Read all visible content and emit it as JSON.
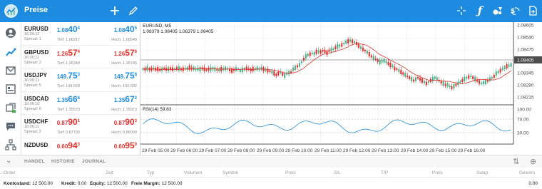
{
  "app": {
    "title": "Preise"
  },
  "toolbar": {
    "icons": [
      "plus-icon",
      "pencil-icon",
      "crosshair-icon",
      "function-icon",
      "shapes-icon",
      "currency-exchange-icon",
      "add-to-chart-icon"
    ]
  },
  "sidebar": {
    "icons": [
      "account-icon",
      "chart-icon",
      "mail-icon",
      "calendar-icon",
      "trade-icon",
      "chat-icon",
      "network-icon"
    ]
  },
  "quotes": [
    {
      "symbol": "EURUSD",
      "time": "16:06:11",
      "spread": "Spread: 1",
      "bid_main": "1.08",
      "bid_big": "40",
      "bid_sup": "4",
      "ask_main": "1.08",
      "ask_big": "40",
      "ask_sup": "5",
      "low": "Tief: 1.08217",
      "high": "Hoch: 1.08549",
      "dir": "up"
    },
    {
      "symbol": "GBPUSD",
      "time": "16:06:11",
      "spread": "Spread: 2",
      "bid_main": "1.26",
      "bid_big": "57",
      "bid_sup": "4",
      "ask_main": "1.26",
      "ask_big": "57",
      "ask_sup": "6",
      "low": "Tief: 1.26349",
      "high": "Hoch: 1.26745",
      "dir": "down"
    },
    {
      "symbol": "USDJPY",
      "time": "16:06:11",
      "spread": "Spread: 5",
      "bid_main": "149.",
      "bid_big": "75",
      "bid_sup": "3",
      "ask_main": "149.",
      "ask_big": "75",
      "ask_sup": "8",
      "low": "Tief: 149.609",
      "high": "Hoch: 150.692",
      "dir": "up"
    },
    {
      "symbol": "USDCAD",
      "time": "16:06:10",
      "spread": "Spread: 6",
      "bid_main": "1.35",
      "bid_big": "66",
      "bid_sup": "6",
      "ask_main": "1.35",
      "ask_big": "67",
      "ask_sup": "2",
      "low": "Tief: 1.35579",
      "high": "Hoch: 1.35973",
      "dir": "up"
    },
    {
      "symbol": "USDCHF",
      "time": "16:06:11",
      "spread": "Spread: 2",
      "bid_main": "0.87",
      "bid_big": "90",
      "bid_sup": "1",
      "ask_main": "0.87",
      "ask_big": "90",
      "ask_sup": "3",
      "low": "Tief: 0.87793",
      "high": "Hoch: 0.88099",
      "dir": "down"
    },
    {
      "symbol": "NZDUSD",
      "time": "",
      "spread": "",
      "bid_main": "0.60",
      "bid_big": "94",
      "bid_sup": "3",
      "ask_main": "0.60",
      "ask_big": "95",
      "ask_sup": "0",
      "low": "",
      "high": "",
      "dir": "down"
    }
  ],
  "chart": {
    "symbol_line": "EURUSD, M5",
    "ohlc_line": "1.08379 1.08405 1.08379 1.08405",
    "rsi_label": "RSI(14) 59.83",
    "price_labels": [
      "1.08605",
      "1.08540",
      "1.08475",
      "1.08405",
      "1.08345",
      "1.08280",
      "1.08215"
    ],
    "current_price": "1.08405",
    "rsi_levels": [
      "100.00",
      "70.00",
      "30.00",
      "0.00"
    ],
    "time_labels": [
      "29 Feb 05:00",
      "29 Feb 06:00",
      "29 Feb 07:00",
      "29 Feb 08:00",
      "29 Feb 09:00",
      "29 Feb 10:00",
      "29 Feb 11:00",
      "29 Feb 12:00",
      "29 Feb 13:00",
      "29 Feb 14:00",
      "29 Feb 15:00",
      "29 Feb 16:00"
    ],
    "up_color": "#4caf87",
    "down_color": "#e2322e",
    "ma_color": "#e2322e",
    "rsi_color": "#1d8ce0"
  },
  "tabs": {
    "trade": "HANDEL",
    "history": "HISTORIE",
    "journal": "JOURNAL"
  },
  "table_headers": [
    "Order",
    "Zeit",
    "Typ",
    "Volumen",
    "Symbol",
    "Preis",
    "S/L",
    "T/P",
    "Preis",
    "Swap",
    "Gewinn"
  ],
  "status": {
    "balance_label": "Kontostand:",
    "balance": "12 500.00",
    "credit_label": "Kredit:",
    "credit": "0.00",
    "equity_label": "Equity:",
    "equity": "12 500.00",
    "free_margin_label": "Freie Margin:",
    "free_margin": "12 500.00",
    "total": "0.00"
  },
  "colors": {
    "accent": "#1d8ce0",
    "up": "#1d8ce0",
    "down": "#e2322e"
  }
}
